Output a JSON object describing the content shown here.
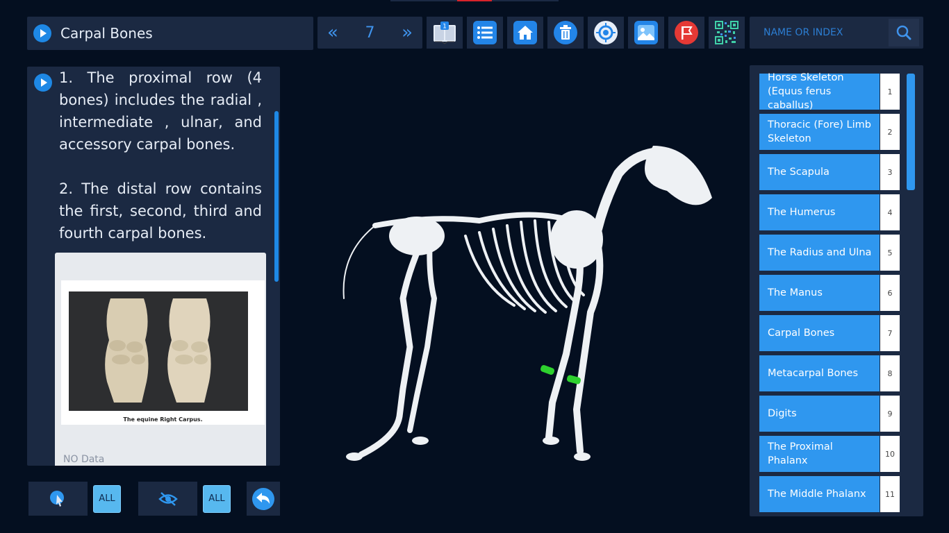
{
  "title_bar": {
    "title": "Carpal Bones"
  },
  "pager": {
    "prev": "«",
    "page": "7",
    "next": "»"
  },
  "toolbar": {
    "book_badge": "1",
    "buttons": [
      "book-icon",
      "list-icon",
      "home-icon",
      "trash-icon",
      "target-icon",
      "image-icon",
      "flag-icon",
      "qr-code-icon"
    ]
  },
  "search": {
    "placeholder": "NAME OR INDEX"
  },
  "description": {
    "para1": "1. The proximal row (4 bones) includes the radial , intermediate , ulnar, and accessory carpal bones.",
    "para2": "2. The distal row contains the first, second, third and fourth carpal bones.",
    "image_caption": "The equine Right Carpus.",
    "no_data": "NO Data"
  },
  "bottom_controls": {
    "select_all_label": "ALL",
    "hide_all_label": "ALL"
  },
  "list": [
    {
      "label": "Horse Skeleton (Equus ferus caballus)",
      "index": "1"
    },
    {
      "label": "Thoracic (Fore) Limb Skeleton",
      "index": "2"
    },
    {
      "label": "The Scapula",
      "index": "3"
    },
    {
      "label": "The Humerus",
      "index": "4"
    },
    {
      "label": "The Radius and Ulna",
      "index": "5"
    },
    {
      "label": "The Manus",
      "index": "6"
    },
    {
      "label": "Carpal Bones",
      "index": "7"
    },
    {
      "label": "Metacarpal Bones",
      "index": "8"
    },
    {
      "label": "Digits",
      "index": "9"
    },
    {
      "label": "The Proximal Phalanx",
      "index": "10"
    },
    {
      "label": "The Middle Phalanx",
      "index": "11"
    }
  ],
  "colors": {
    "accent": "#2f97ef",
    "panel": "#1b2942",
    "background": "#040f20",
    "highlight": "#2ed12e"
  }
}
